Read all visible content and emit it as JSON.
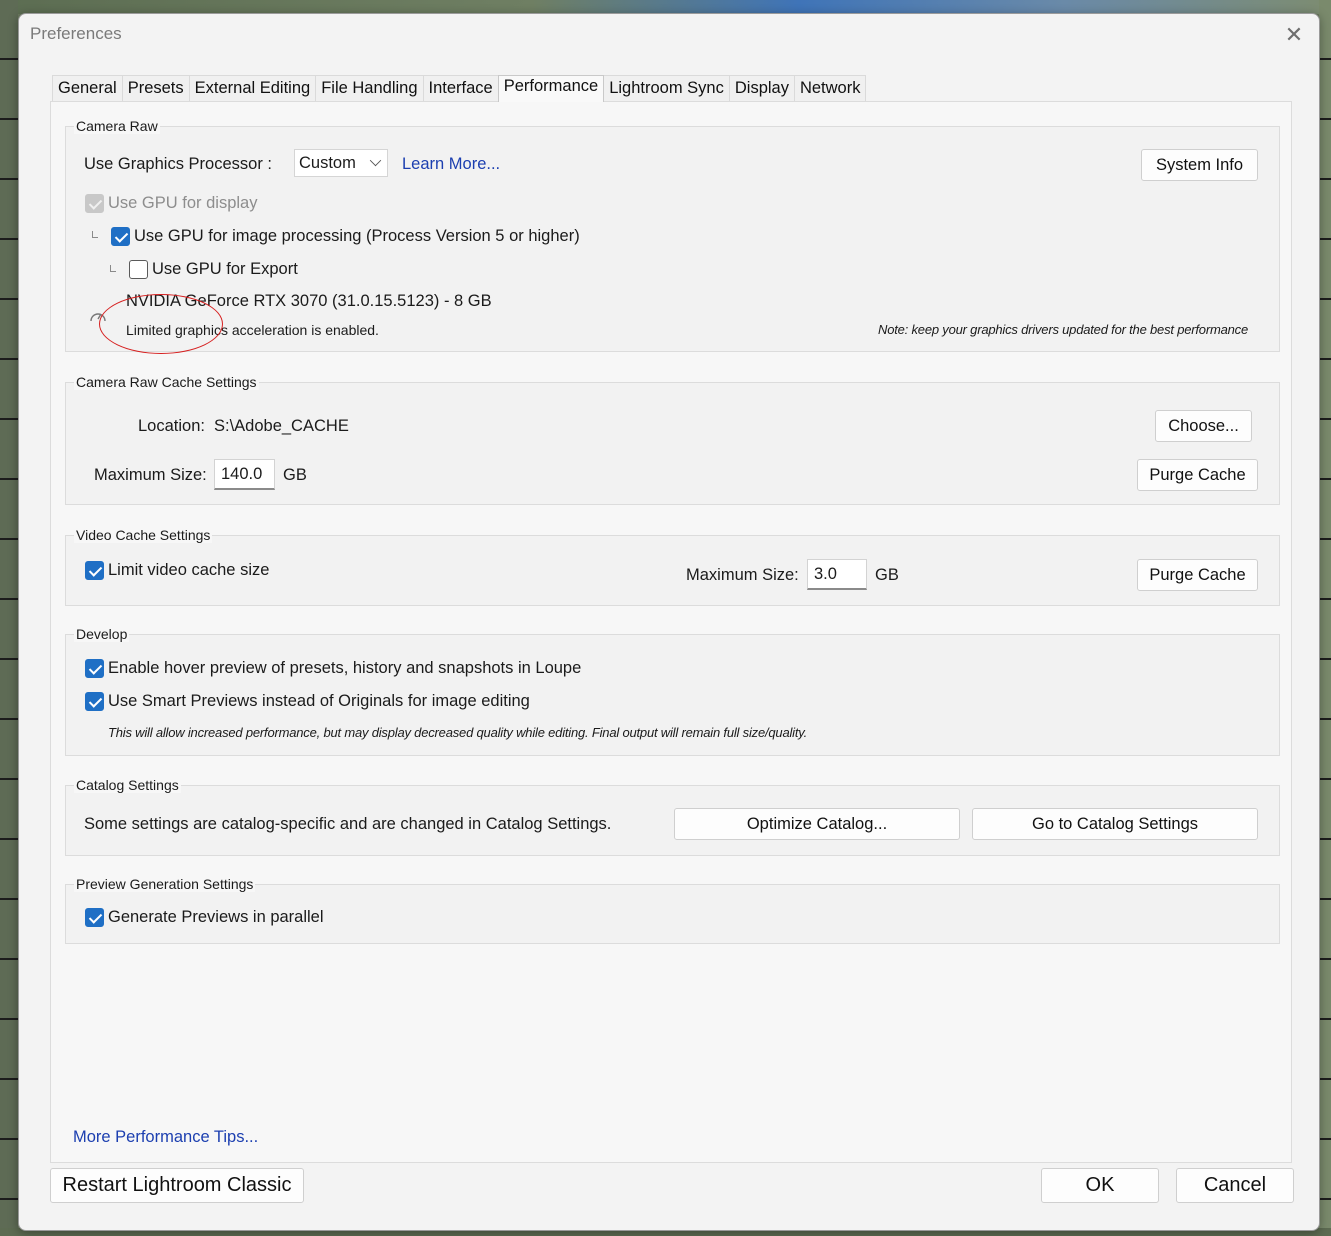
{
  "window": {
    "title": "Preferences",
    "close_icon": "close-icon"
  },
  "tabs": [
    {
      "label": "General"
    },
    {
      "label": "Presets"
    },
    {
      "label": "External Editing"
    },
    {
      "label": "File Handling"
    },
    {
      "label": "Interface"
    },
    {
      "label": "Performance",
      "active": true
    },
    {
      "label": "Lightroom Sync"
    },
    {
      "label": "Display"
    },
    {
      "label": "Network"
    }
  ],
  "camera_raw": {
    "group_label": "Camera Raw",
    "gpu_label": "Use Graphics Processor :",
    "gpu_select_value": "Custom",
    "learn_more": "Learn More...",
    "system_info_button": "System Info",
    "use_gpu_display": {
      "label": "Use GPU for display",
      "checked": true,
      "disabled": true
    },
    "use_gpu_processing": {
      "label": "Use GPU for image processing (Process Version 5 or higher)",
      "checked": true
    },
    "use_gpu_export": {
      "label": "Use GPU for Export",
      "checked": false
    },
    "gpu_name": "NVIDIA GeForce RTX 3070 (31.0.15.5123) - 8 GB",
    "status": "Limited graphics acceleration is enabled.",
    "note": "Note: keep your graphics drivers updated for the best performance",
    "status_icon": "gauge-icon"
  },
  "camera_raw_cache": {
    "group_label": "Camera Raw Cache Settings",
    "location_label": "Location:",
    "location_value": "S:\\Adobe_CACHE",
    "choose_button": "Choose...",
    "max_size_label": "Maximum Size:",
    "max_size_value": "140.0",
    "unit": "GB",
    "purge_button": "Purge Cache"
  },
  "video_cache": {
    "group_label": "Video Cache Settings",
    "limit_label": "Limit video cache size",
    "limit_checked": true,
    "max_size_label": "Maximum Size:",
    "max_size_value": "3.0",
    "unit": "GB",
    "purge_button": "Purge Cache"
  },
  "develop": {
    "group_label": "Develop",
    "hover_preview": {
      "label": "Enable hover preview of presets, history and snapshots in Loupe",
      "checked": true
    },
    "smart_previews": {
      "label": "Use Smart Previews instead of Originals for image editing",
      "checked": true
    },
    "smart_note": "This will allow increased performance, but may display decreased quality while editing. Final output will remain full size/quality."
  },
  "catalog": {
    "group_label": "Catalog Settings",
    "description": "Some settings are catalog-specific and are changed in Catalog Settings.",
    "optimize_button": "Optimize Catalog...",
    "goto_button": "Go to Catalog Settings"
  },
  "preview_generation": {
    "group_label": "Preview Generation Settings",
    "parallel": {
      "label": "Generate Previews in parallel",
      "checked": true
    }
  },
  "footer": {
    "tips_link": "More Performance Tips...",
    "restart_button": "Restart Lightroom Classic",
    "ok_button": "OK",
    "cancel_button": "Cancel"
  },
  "colors": {
    "accent": "#1f6fc5",
    "link": "#1c3fb0",
    "annotation": "#d62020"
  }
}
